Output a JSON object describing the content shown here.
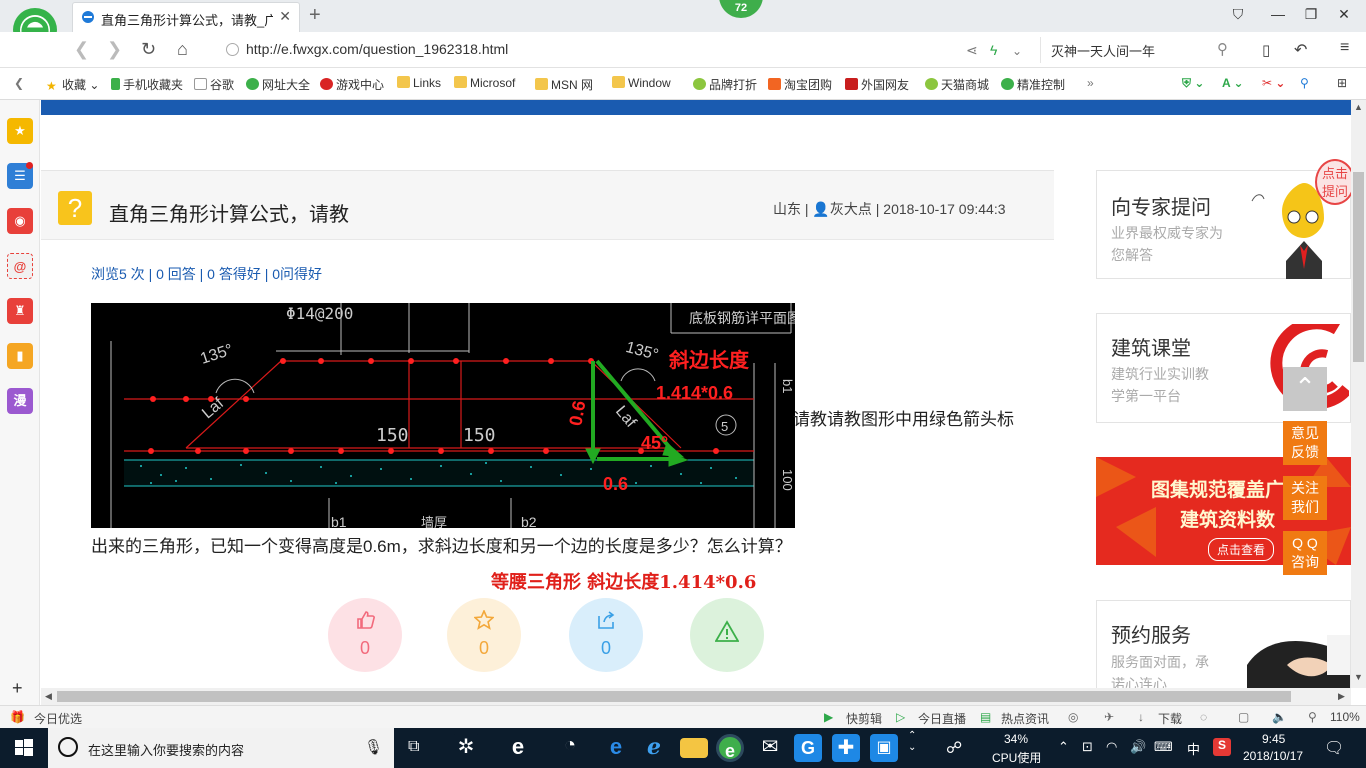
{
  "browser": {
    "tab_title": "直角三角形计算公式，请教_广联",
    "badge": "72",
    "url": "http://e.fwxgx.com/question_1962318.html",
    "search_text": "灭神一天人间一年"
  },
  "bookmarks": [
    "收藏",
    "手机收藏夹",
    "谷歌",
    "网址大全",
    "游戏中心",
    "Links",
    "Microsof",
    "MSN 网",
    "Window",
    "品牌打折",
    "淘宝团购",
    "外国网友",
    "天猫商城",
    "精准控制"
  ],
  "question": {
    "title": "直角三角形计算公式，请教",
    "region": "山东",
    "user": "灰大点",
    "datetime": "2018-10-17 09:44:3",
    "stats": "浏览5 次 | 0 回答 | 0 答得好 | 0问得好",
    "text_part1": "请教请教图形中用绿色箭头标",
    "text_part2": "出来的三角形，已知一个变得高度是0.6m，求斜边长度和另一个边的长度是多少？怎么计算？",
    "red_note": "等腰三角形    斜边长度1.414*0.6",
    "buttons": [
      {
        "name": "like",
        "count": "0",
        "color": "#f26a7c",
        "bg": "#fde1e5"
      },
      {
        "name": "favorite",
        "count": "0",
        "color": "#f3a83b",
        "bg": "#fdf0d9"
      },
      {
        "name": "share",
        "count": "0",
        "color": "#3aa0e6",
        "bg": "#d9eefb"
      },
      {
        "name": "report",
        "count": "",
        "color": "#3cb04a",
        "bg": "#dcf2dc"
      }
    ]
  },
  "cad": {
    "label_rebar": "Φ14@200",
    "label_plan": "底板钢筋详平面图",
    "angle_left": "135°",
    "angle_right": "135°",
    "laf_left": "Laf",
    "laf_right": "Laf",
    "dim1": "150",
    "dim2": "150",
    "circle_num": "5",
    "b1": "b1",
    "b2": "b2",
    "thick": "墙厚",
    "side_100": "100",
    "red_title": "斜边长度",
    "red_formula": "1.414*0.6",
    "red_06_vertical": "0.6",
    "red_45": "45°",
    "red_06_bottom": "0.6"
  },
  "right": {
    "expert_title": "向专家提问",
    "expert_sub": "业界最权威专家为您解答",
    "bubble": "点击提问",
    "class_title": "建筑课堂",
    "class_sub": "建筑行业实训教学第一平台",
    "banner_line1": "图集规范覆盖广",
    "banner_line2": "建筑资料数",
    "banner_btn": "点击查看",
    "service_title": "预约服务",
    "service_sub": "服务面对面，承诺心连心",
    "float_feedback": "意见反馈",
    "float_follow": "关注我们",
    "float_qq": "Q Q咨询"
  },
  "statusbar": {
    "left": "今日优选",
    "items": [
      "快剪辑",
      "今日直播",
      "热点资讯",
      "下载"
    ],
    "zoom": "110%"
  },
  "taskbar": {
    "search_placeholder": "在这里输入你要搜索的内容",
    "cpu_percent": "34%",
    "cpu_label": "CPU使用",
    "ime": "中",
    "time": "9:45",
    "date": "2018/10/17"
  }
}
